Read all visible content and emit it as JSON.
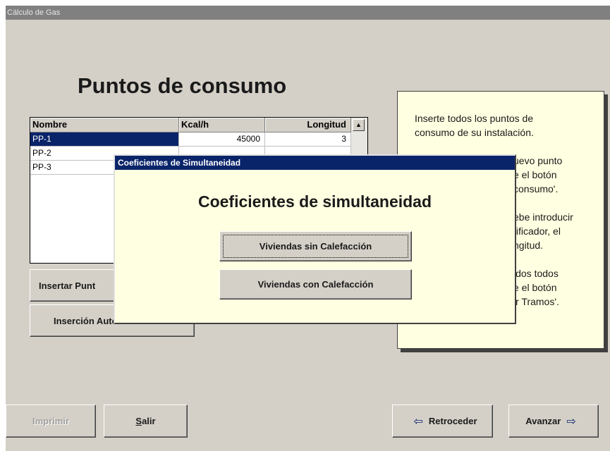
{
  "window": {
    "title": "Cálculo de Gas"
  },
  "page": {
    "heading": "Puntos de consumo"
  },
  "table": {
    "columns": [
      "Nombre",
      "Kcal/h",
      "Longitud"
    ],
    "rows": [
      {
        "nombre": "PP-1",
        "kcal": "45000",
        "longitud": "3"
      },
      {
        "nombre": "PP-2",
        "kcal": "",
        "longitud": ""
      },
      {
        "nombre": "PP-3",
        "kcal": "",
        "longitud": ""
      }
    ],
    "scroll_up_icon": "arrow-up-icon"
  },
  "actions": {
    "insert_label": "Insertar Punt",
    "auto_insert_label": "Inserción Automática",
    "auto_insert_visible": "Inserción "
  },
  "help": {
    "lines": [
      "Inserte todos los puntos de",
      "consumo de su instalación.",
      "uevo punto",
      "e el botón",
      "consumo'.",
      "ebe introducir",
      "tificador, el",
      "ngitud.",
      "idos todos",
      "e el botón",
      "ir Tramos'."
    ]
  },
  "dialog": {
    "title": "Coeficientes de Simultaneidad",
    "heading": "Coeficientes de simultaneidad",
    "btn_sin": "Viviendas sin Calefacción",
    "btn_con": "Viviendas con Calefacción"
  },
  "footer": {
    "print_label": "Imprimir",
    "exit_label_first": "S",
    "exit_label_rest": "alir",
    "back_label": "Retroceder",
    "back_icon": "arrow-left-icon",
    "next_label": "Avanzar",
    "next_icon": "arrow-right-icon"
  }
}
